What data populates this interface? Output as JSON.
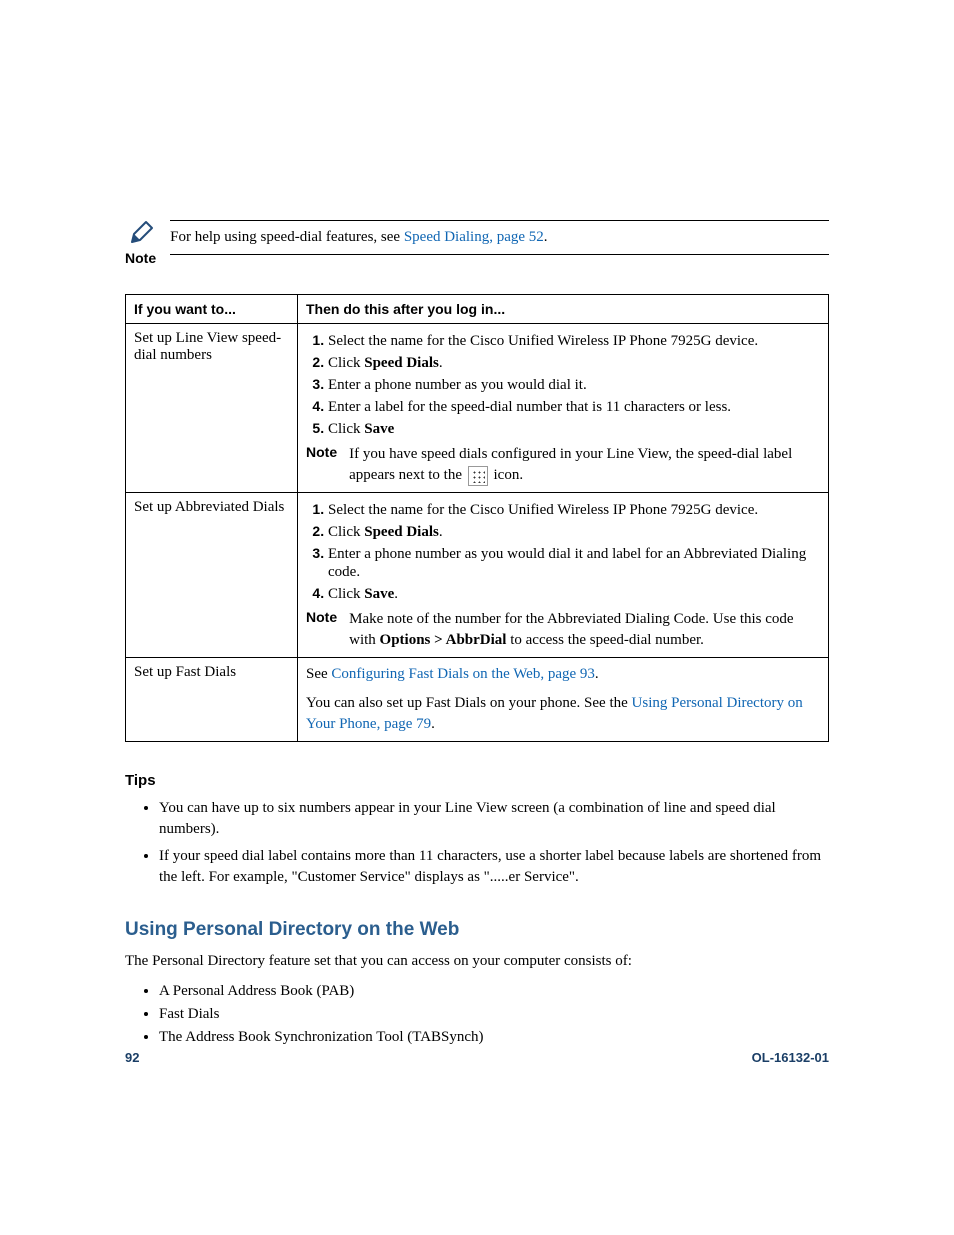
{
  "note": {
    "label": "Note",
    "prefix": "For help using speed-dial features, see ",
    "link": "Speed Dialing, page 52",
    "suffix": "."
  },
  "table": {
    "header_left": "If you want to...",
    "header_right": "Then do this after you log in...",
    "rows": [
      {
        "left": "Set up Line View speed-dial numbers",
        "steps": [
          {
            "pre": "Select the name for the Cisco Unified Wireless IP Phone 7925G device."
          },
          {
            "pre": "Click ",
            "bold": "Speed Dials",
            "post": "."
          },
          {
            "pre": "Enter a phone number as you would dial it."
          },
          {
            "pre": "Enter a label for the speed-dial number that is 11 characters or less."
          },
          {
            "pre": "Click ",
            "bold": "Save"
          }
        ],
        "note": {
          "label": "Note",
          "text_pre": "If you have speed dials configured in your Line View, the speed-dial label appears next to the ",
          "icon": true,
          "text_post": " icon."
        }
      },
      {
        "left": "Set up Abbreviated Dials",
        "steps": [
          {
            "pre": "Select the name for the Cisco Unified Wireless IP Phone 7925G device."
          },
          {
            "pre": "Click ",
            "bold": "Speed Dials",
            "post": "."
          },
          {
            "pre": "Enter a phone number as you would dial it and label for an Abbreviated Dialing code."
          },
          {
            "pre": "Click ",
            "bold": "Save",
            "post": "."
          }
        ],
        "note": {
          "label": "Note",
          "text_pre": "Make note of the number for the Abbreviated Dialing Code. Use this code with ",
          "bold": "Options > AbbrDial",
          "text_post": " to access the speed-dial number."
        }
      },
      {
        "left": "Set up Fast Dials",
        "line1_pre": "See ",
        "line1_link": "Configuring Fast Dials on the Web, page 93",
        "line1_post": ".",
        "line2_pre": "You can also set up Fast Dials on your phone. See the ",
        "line2_link": "Using Personal Directory on Your Phone, page 79",
        "line2_post": "."
      }
    ]
  },
  "tips": {
    "heading": "Tips",
    "items": [
      "You can have up to six numbers appear in your Line View screen (a combination of line and speed dial numbers).",
      "If your speed dial label contains more than 11 characters, use a shorter label because labels are shortened from the left. For example, \"Customer Service\" displays as \".....er Service\"."
    ]
  },
  "section": {
    "heading": "Using Personal Directory on the Web",
    "intro": "The Personal Directory feature set that you can access on your computer consists of:",
    "items": [
      "A Personal Address Book (PAB)",
      "Fast Dials",
      "The Address Book Synchronization Tool (TABSynch)"
    ]
  },
  "footer": {
    "page": "92",
    "docid": "OL-16132-01"
  }
}
